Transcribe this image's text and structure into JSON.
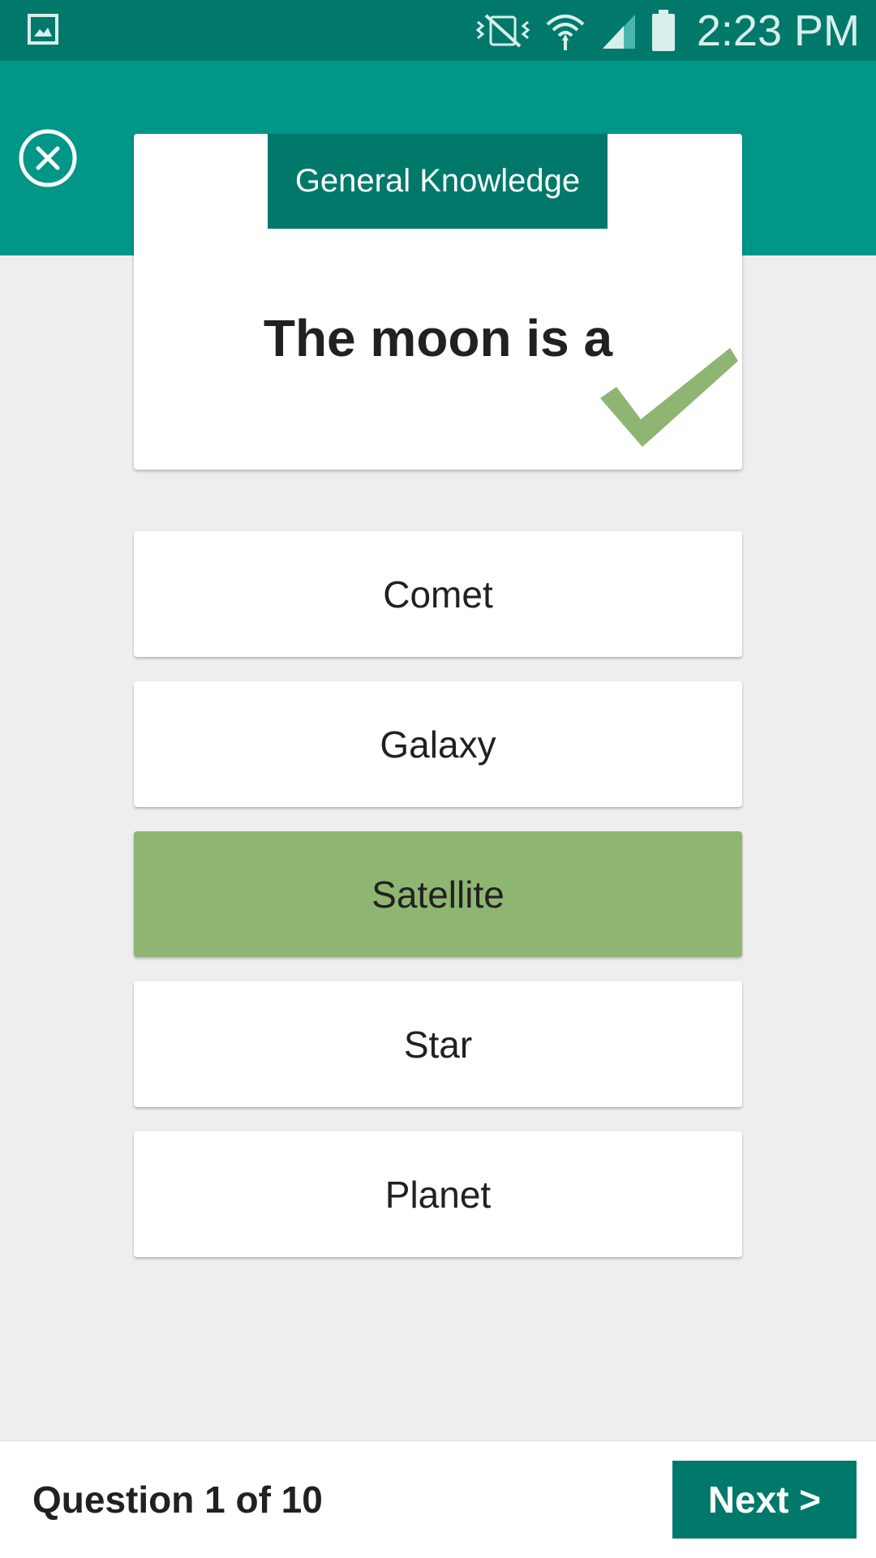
{
  "status_bar": {
    "time": "2:23 PM",
    "icons": [
      "gallery-icon",
      "vibrate-icon",
      "wifi-icon",
      "signal-icon",
      "battery-icon"
    ]
  },
  "quiz": {
    "category": "General Knowledge",
    "question": "The moon is a",
    "answers": [
      {
        "label": "Comet",
        "correct": false
      },
      {
        "label": "Galaxy",
        "correct": false
      },
      {
        "label": "Satellite",
        "correct": true
      },
      {
        "label": "Star",
        "correct": false
      },
      {
        "label": "Planet",
        "correct": false
      }
    ]
  },
  "footer": {
    "progress": "Question 1 of 10",
    "next_label": "Next >"
  },
  "colors": {
    "primary_dark": "#00796b",
    "primary": "#009688",
    "correct": "#8fb573",
    "background": "#eeeeee"
  }
}
